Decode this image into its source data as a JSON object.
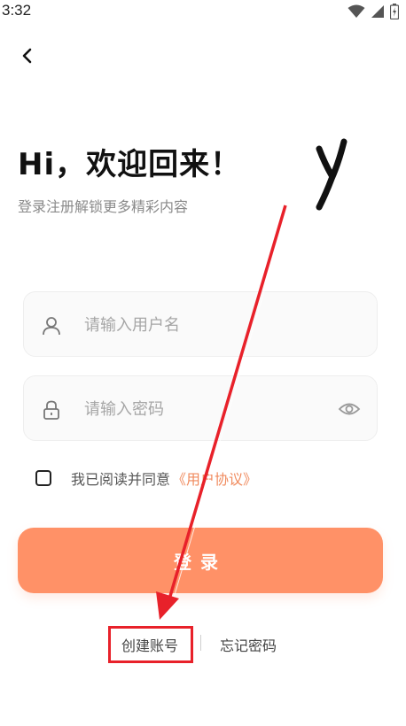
{
  "status_bar": {
    "time": "3:32",
    "icons": [
      "wifi-icon",
      "signal-icon",
      "battery-icon"
    ]
  },
  "header": {
    "back_icon": "chevron-left-icon"
  },
  "welcome": {
    "title": "Hi，欢迎回来！",
    "subtitle": "登录注册解锁更多精彩内容"
  },
  "form": {
    "username": {
      "icon": "user-icon",
      "placeholder": "请输入用户名",
      "value": ""
    },
    "password": {
      "icon": "lock-icon",
      "placeholder": "请输入密码",
      "value": "",
      "toggle_icon": "eye-icon"
    },
    "agreement": {
      "checked": false,
      "text": "我已阅读并同意",
      "link": "《用户协议》"
    },
    "login_label": "登录"
  },
  "footer": {
    "create_account": "创建账号",
    "forgot_password": "忘记密码"
  },
  "colors": {
    "accent": "#ff9167",
    "link": "#f08a5d",
    "annotation": "#e8212a"
  }
}
